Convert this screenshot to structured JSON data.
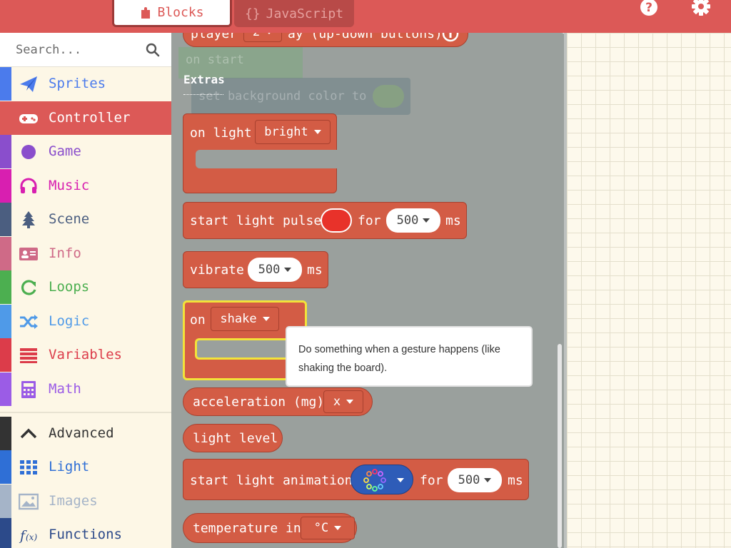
{
  "header": {
    "tabs": [
      {
        "label": "Blocks",
        "active": true
      },
      {
        "label": "JavaScript",
        "prefix": "{}",
        "active": false
      }
    ],
    "help_icon": "help-circle-icon",
    "settings_icon": "gear-icon",
    "colors": {
      "header": "#dc5957"
    }
  },
  "sidebar": {
    "search_placeholder": "Search...",
    "categories": [
      {
        "label": "Sprites",
        "icon": "paper-plane-icon",
        "color": "#4b7bec"
      },
      {
        "label": "Controller",
        "icon": "gamepad-icon",
        "color": "#dc5957",
        "active": true
      },
      {
        "label": "Game",
        "icon": "circle-icon",
        "color": "#8a4ecc"
      },
      {
        "label": "Music",
        "icon": "headphones-icon",
        "color": "#d81fb0"
      },
      {
        "label": "Scene",
        "icon": "tree-icon",
        "color": "#4b5e80"
      },
      {
        "label": "Info",
        "icon": "id-card-icon",
        "color": "#cf6a87"
      },
      {
        "label": "Loops",
        "icon": "refresh-icon",
        "color": "#4caf50"
      },
      {
        "label": "Logic",
        "icon": "shuffle-icon",
        "color": "#4f9ae8"
      },
      {
        "label": "Variables",
        "icon": "list-icon",
        "color": "#dc3c4a"
      },
      {
        "label": "Math",
        "icon": "calculator-icon",
        "color": "#9b5ce6"
      },
      {
        "label": "Advanced",
        "icon": "chevron-up-icon",
        "color": "#333333"
      },
      {
        "label": "Light",
        "icon": "grid-icon",
        "color": "#2f6fd6"
      },
      {
        "label": "Images",
        "icon": "image-icon",
        "color": "#a5b4c8"
      },
      {
        "label": "Functions",
        "icon": "function-icon",
        "color": "#2c4a8a"
      }
    ]
  },
  "flyout": {
    "top_partial": {
      "text_a": "player",
      "value": "2",
      "text_b": "ay (up-down buttons)"
    },
    "faded_on_start": "on start",
    "faded_bg": "set background color to",
    "section_label": "Extras",
    "blocks": {
      "on_light": {
        "text": "on light",
        "dropdown": "bright"
      },
      "light_pulse": {
        "text": "start light pulse",
        "for": "for",
        "value": "500",
        "unit": "ms",
        "color": "#e8322a"
      },
      "vibrate": {
        "text": "vibrate",
        "value": "500",
        "unit": "ms"
      },
      "on_shake": {
        "text": "on",
        "dropdown": "shake"
      },
      "acceleration": {
        "text": "acceleration (mg)",
        "dropdown": "x"
      },
      "light_level": {
        "text": "light level"
      },
      "light_animation": {
        "text": "start light animation",
        "for": "for",
        "value": "500",
        "unit": "ms"
      },
      "temperature": {
        "text": "temperature in",
        "dropdown": "°C"
      }
    },
    "tooltip": "Do something when a gesture happens (like shaking the board)."
  }
}
